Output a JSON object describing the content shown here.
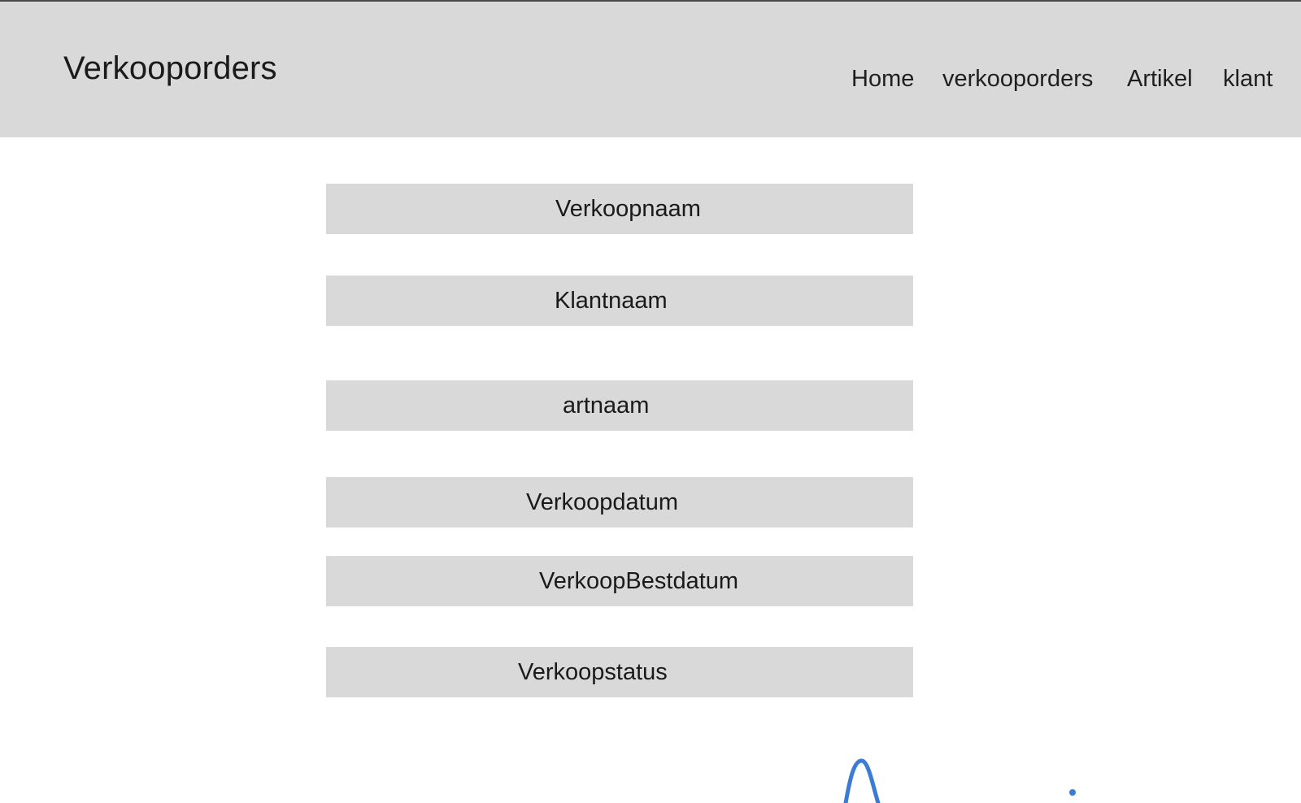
{
  "header": {
    "title": "Verkooporders",
    "background_color": "#d9d9d9"
  },
  "nav": {
    "items": [
      {
        "label": "Home"
      },
      {
        "label": "verkooporders"
      },
      {
        "label": "Artikel"
      },
      {
        "label": "klant"
      }
    ]
  },
  "fields": [
    {
      "label": "Verkoopnaam"
    },
    {
      "label": "Klantnaam"
    },
    {
      "label": "artnaam"
    },
    {
      "label": "Verkoopdatum"
    },
    {
      "label": "VerkoopBestdatum"
    },
    {
      "label": "Verkoopstatus"
    }
  ],
  "colors": {
    "field_background": "#d9d9d9",
    "page_background": "#ffffff",
    "sketch_stroke": "#3a7bd5"
  },
  "decorations": {
    "sketch": "blue-pen-scribble"
  }
}
